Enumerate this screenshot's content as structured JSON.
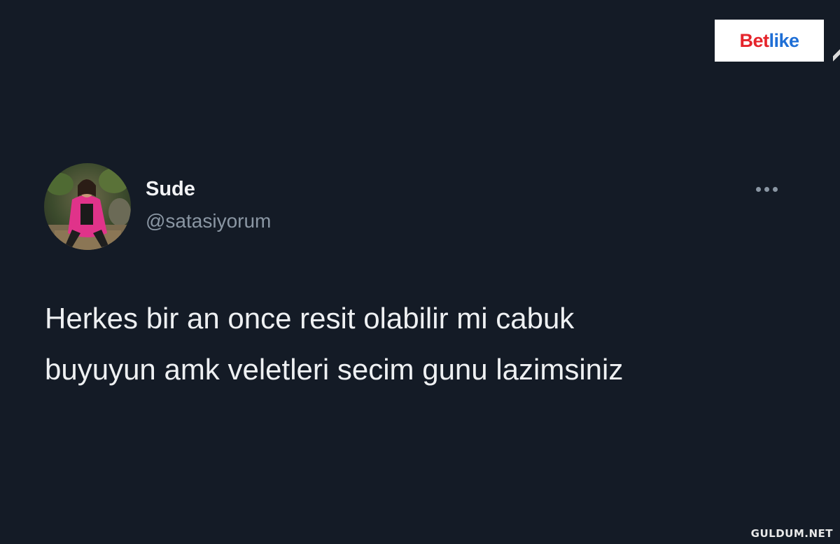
{
  "sponsor": {
    "name": "Betlike",
    "part_a": "Bet",
    "part_b": "like",
    "color_a": "#e5242b",
    "color_b": "#1f6fd6"
  },
  "tweet": {
    "author": {
      "display_name": "Sude",
      "handle": "@satasiyorum"
    },
    "text_lines": [
      "Herkes bir an once resit olabilir mi cabuk",
      "buyuyun amk veletleri secim gunu lazimsiniz"
    ],
    "more_icon": "ellipsis-icon"
  },
  "watermark": "GULDUM.NET",
  "colors": {
    "background": "#141b26",
    "text_primary": "#eef0f2",
    "text_secondary": "#8a96a3"
  }
}
